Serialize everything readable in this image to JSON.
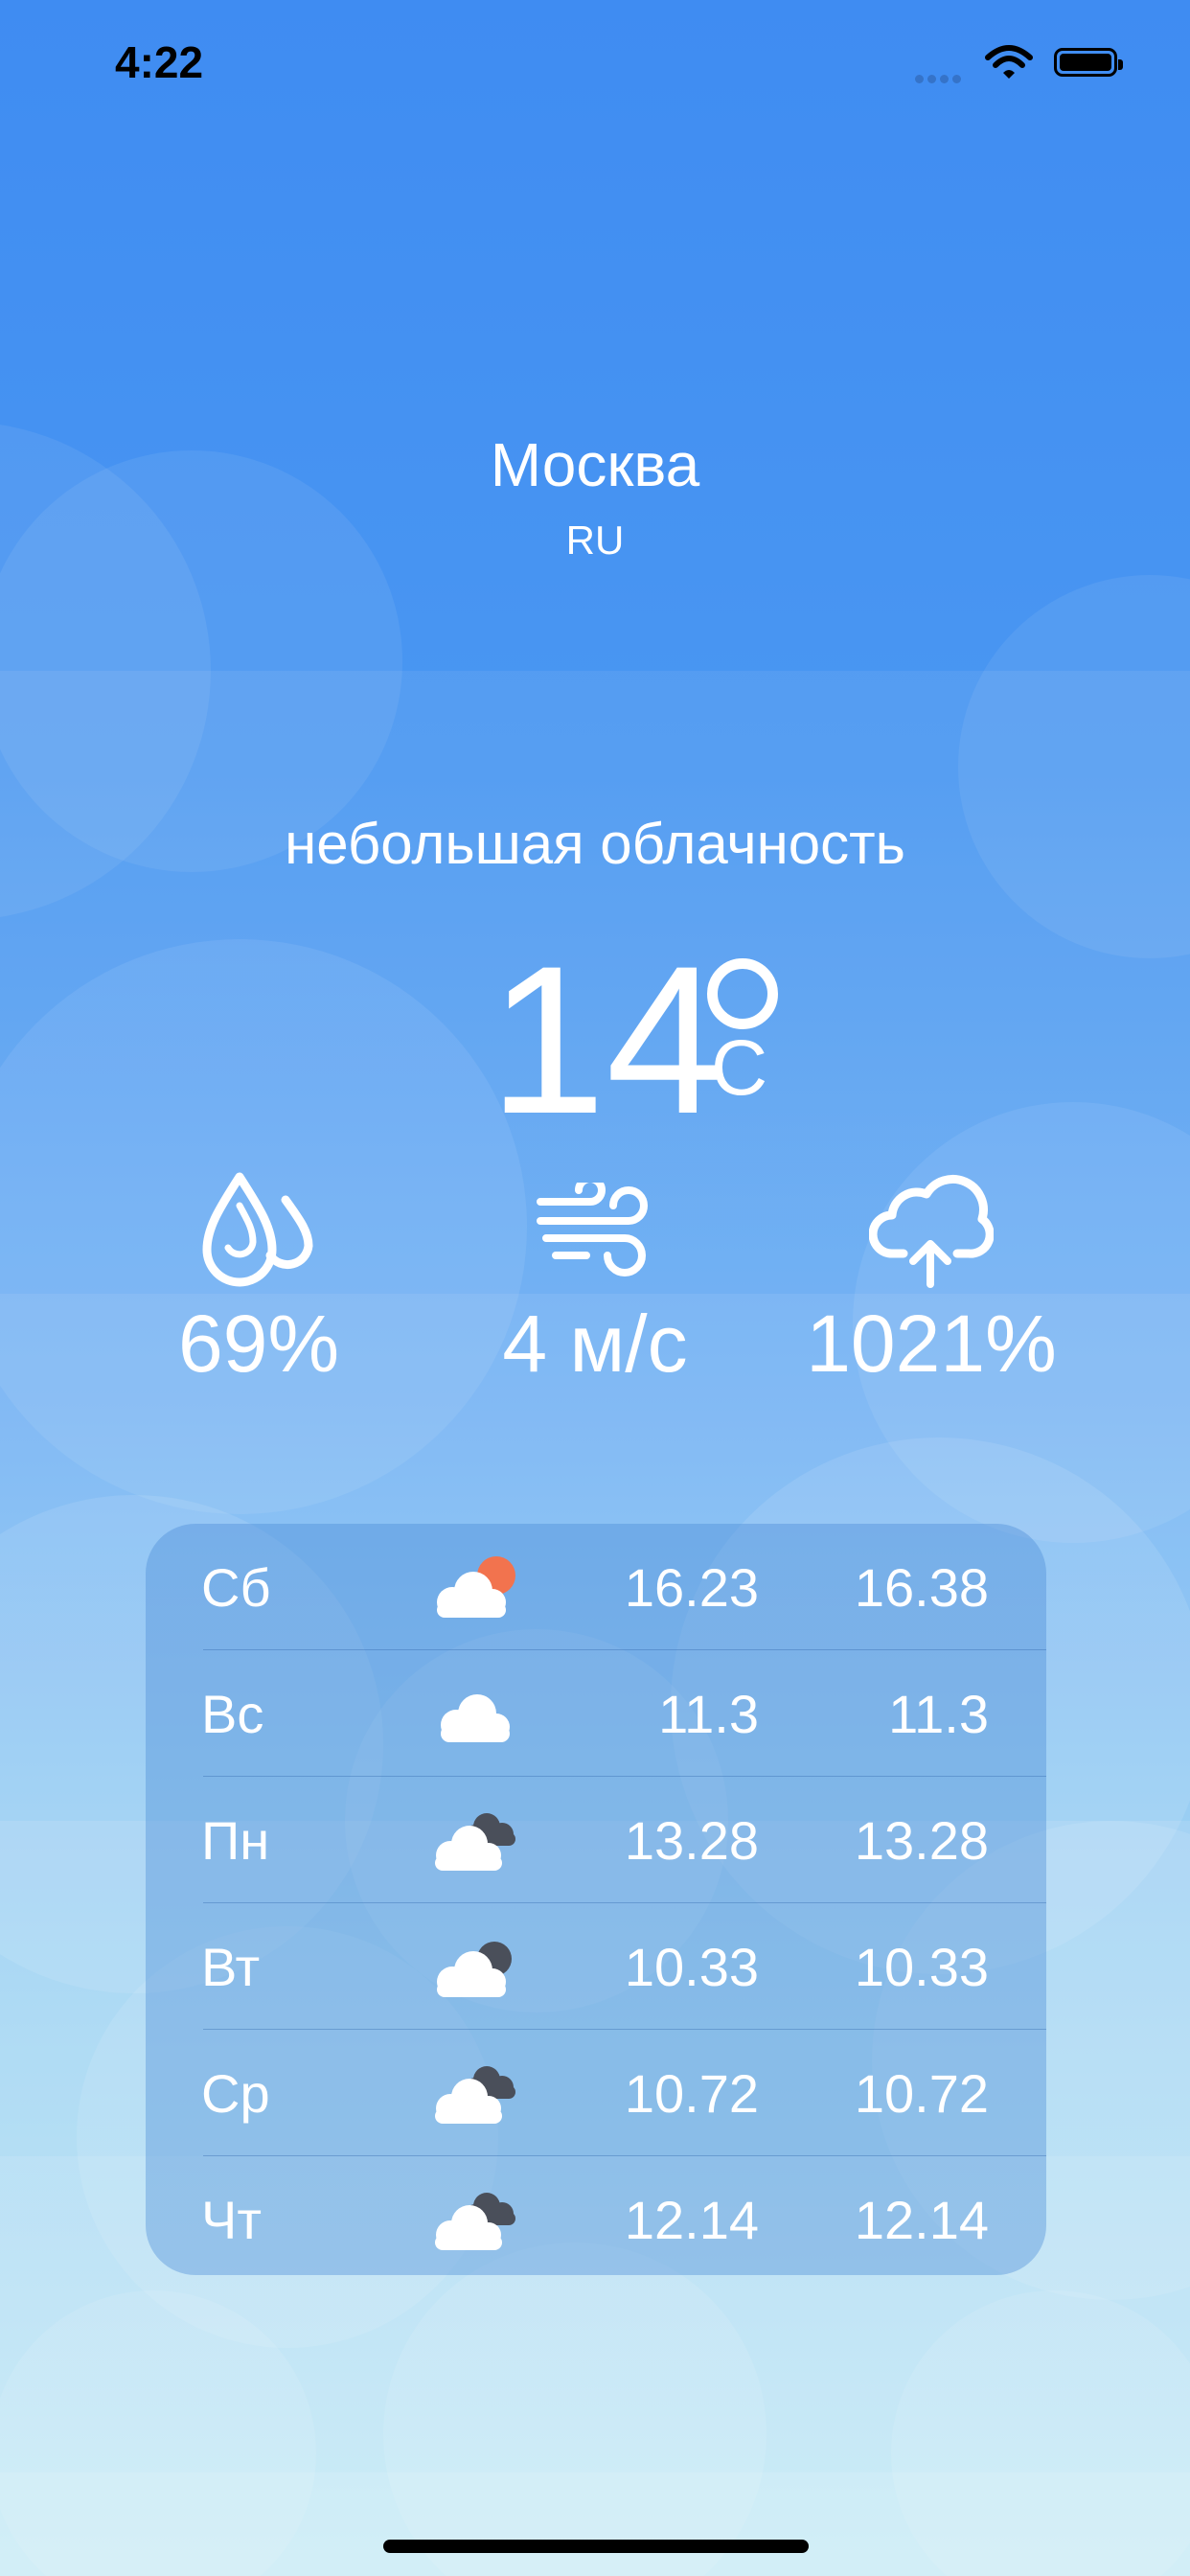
{
  "status_bar": {
    "time": "4:22"
  },
  "location": {
    "city": "Москва",
    "country": "RU"
  },
  "current": {
    "description": "небольшая облачность",
    "temperature": "14",
    "unit": "C",
    "humidity": {
      "icon": "humidity-drops-icon",
      "value": "69%"
    },
    "wind": {
      "icon": "wind-icon",
      "value": "4 м/с"
    },
    "pressure": {
      "icon": "pressure-cloud-icon",
      "value": "1021%"
    }
  },
  "forecast": [
    {
      "day": "Сб",
      "icon": "partly-cloudy-day-icon",
      "temp_a": "16.23",
      "temp_b": "16.38"
    },
    {
      "day": "Вс",
      "icon": "cloud-icon",
      "temp_a": "11.3",
      "temp_b": "11.3"
    },
    {
      "day": "Пн",
      "icon": "broken-clouds-icon",
      "temp_a": "13.28",
      "temp_b": "13.28"
    },
    {
      "day": "Вт",
      "icon": "partly-cloudy-night-icon",
      "temp_a": "10.33",
      "temp_b": "10.33"
    },
    {
      "day": "Ср",
      "icon": "broken-clouds-icon",
      "temp_a": "10.72",
      "temp_b": "10.72"
    },
    {
      "day": "Чт",
      "icon": "broken-clouds-icon",
      "temp_a": "12.14",
      "temp_b": "12.14"
    }
  ],
  "colors": {
    "background_top": "#3f8cf2",
    "background_bottom": "#b9e6f3",
    "sun": "#f2734e",
    "dark_cloud": "#4a4f5a"
  }
}
